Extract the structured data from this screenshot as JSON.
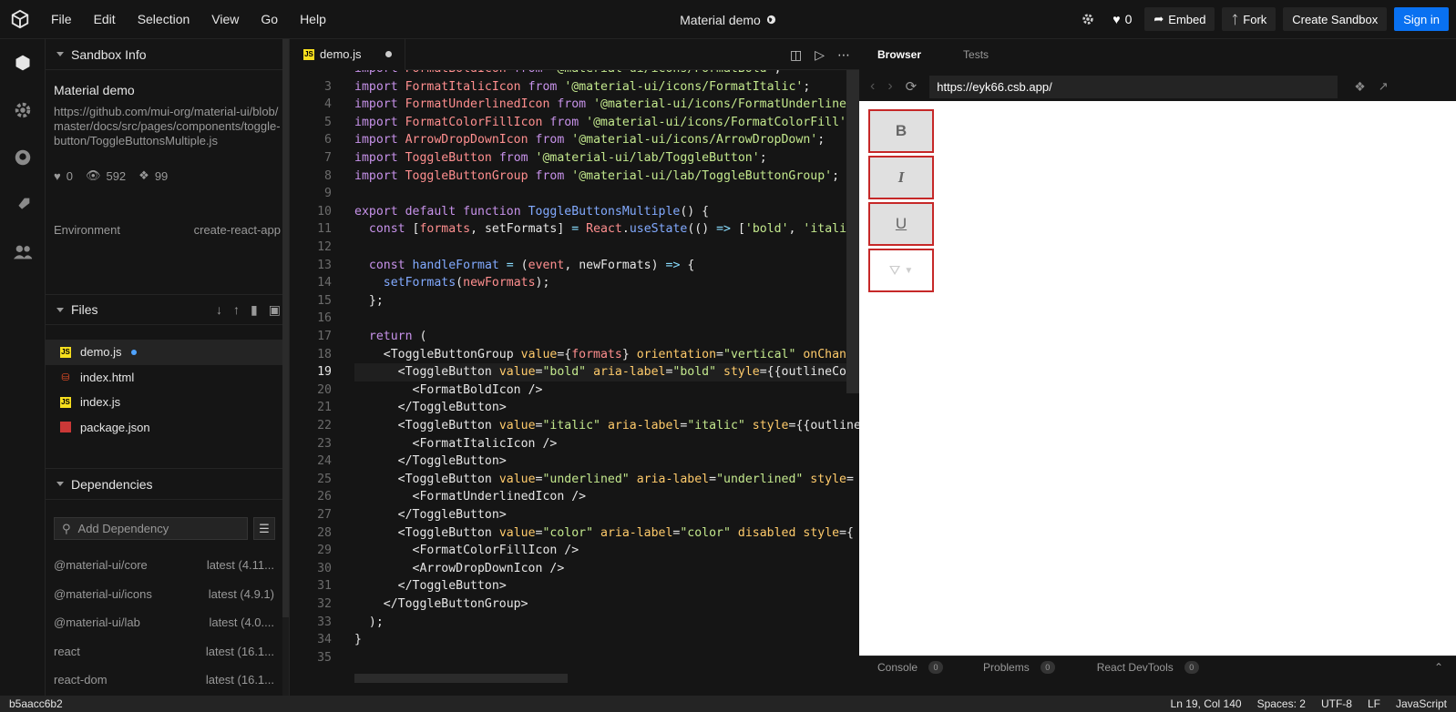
{
  "menu": [
    "File",
    "Edit",
    "Selection",
    "View",
    "Go",
    "Help"
  ],
  "title": "Material demo",
  "topbar": {
    "likes": "0",
    "embed": "Embed",
    "fork": "Fork",
    "create": "Create Sandbox",
    "signin": "Sign in"
  },
  "sidebar": {
    "info_head": "Sandbox Info",
    "name": "Material demo",
    "url": "https://github.com/mui-org/material-ui/blob/master/docs/src/pages/components/toggle-button/ToggleButtonsMultiple.js",
    "likes": "0",
    "views": "592",
    "forks": "99",
    "env_label": "Environment",
    "env_value": "create-react-app",
    "files_head": "Files",
    "files": [
      {
        "name": "demo.js",
        "type": "js"
      },
      {
        "name": "index.html",
        "type": "html"
      },
      {
        "name": "index.js",
        "type": "js"
      },
      {
        "name": "package.json",
        "type": "npm"
      }
    ],
    "deps_head": "Dependencies",
    "dep_placeholder": "Add Dependency",
    "deps": [
      {
        "name": "@material-ui/core",
        "ver": "latest (4.11..."
      },
      {
        "name": "@material-ui/icons",
        "ver": "latest (4.9.1)"
      },
      {
        "name": "@material-ui/lab",
        "ver": "latest (4.0...."
      },
      {
        "name": "react",
        "ver": "latest (16.1..."
      },
      {
        "name": "react-dom",
        "ver": "latest (16.1..."
      }
    ]
  },
  "editor": {
    "tab": "demo.js",
    "lines": [
      "3",
      "4",
      "5",
      "6",
      "7",
      "8",
      "9",
      "10",
      "11",
      "12",
      "13",
      "14",
      "15",
      "16",
      "17",
      "18",
      "19",
      "20",
      "21",
      "22",
      "23",
      "24",
      "25",
      "26",
      "27",
      "28",
      "29",
      "30",
      "31",
      "32",
      "33",
      "34",
      "35"
    ]
  },
  "browser": {
    "tab_browser": "Browser",
    "tab_tests": "Tests",
    "url": "https://eyk66.csb.app/",
    "buttons": [
      "B",
      "I",
      "U"
    ],
    "bottom": [
      {
        "label": "Console",
        "count": "0"
      },
      {
        "label": "Problems",
        "count": "0"
      },
      {
        "label": "React DevTools",
        "count": "0"
      }
    ]
  },
  "status": {
    "commit": "b5aacc6b2",
    "pos": "Ln 19, Col 140",
    "spaces": "Spaces: 2",
    "enc": "UTF-8",
    "eol": "LF",
    "lang": "JavaScript"
  },
  "colors": {
    "accent": "#0971f1",
    "bg": "#151515",
    "red_border": "#c62828"
  }
}
